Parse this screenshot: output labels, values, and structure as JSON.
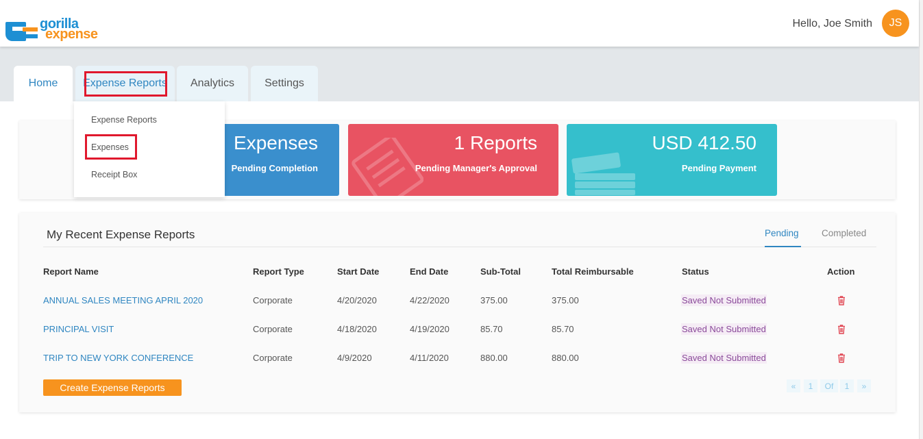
{
  "header": {
    "logo": {
      "word1": "gorilla",
      "word2": "expense"
    },
    "greeting": "Hello, Joe Smith",
    "avatar_initials": "JS"
  },
  "tabs": [
    {
      "label": "Home",
      "active": true
    },
    {
      "label": "Expense Reports",
      "highlighted": true
    },
    {
      "label": "Analytics"
    },
    {
      "label": "Settings"
    }
  ],
  "dropdown": {
    "items": [
      {
        "label": "Expense Reports"
      },
      {
        "label": "Expenses",
        "highlighted": true
      },
      {
        "label": "Receipt Box"
      }
    ]
  },
  "summary_cards": [
    {
      "amount": "Expenses",
      "caption": "Pending Completion",
      "color": "#3a8fcd"
    },
    {
      "amount": "1 Reports",
      "caption": "Pending Manager's Approval",
      "color": "#e85362"
    },
    {
      "amount": "USD 412.50",
      "caption": "Pending Payment",
      "color": "#35bfcc"
    }
  ],
  "reports": {
    "title": "My Recent Expense Reports",
    "filter_tabs": {
      "pending": "Pending",
      "completed": "Completed",
      "active": "Pending"
    },
    "columns": [
      "Report Name",
      "Report Type",
      "Start Date",
      "End Date",
      "Sub-Total",
      "Total Reimbursable",
      "Status",
      "Action"
    ],
    "rows": [
      {
        "name": "ANNUAL SALES MEETING APRIL 2020",
        "type": "Corporate",
        "start": "4/20/2020",
        "end": "4/22/2020",
        "subtotal": "375.00",
        "reimbursable": "375.00",
        "status": "Saved Not Submitted",
        "action_icon": "trash-icon"
      },
      {
        "name": "PRINCIPAL VISIT",
        "type": "Corporate",
        "start": "4/18/2020",
        "end": "4/19/2020",
        "subtotal": "85.70",
        "reimbursable": "85.70",
        "status": "Saved Not Submitted",
        "action_icon": "trash-icon"
      },
      {
        "name": "TRIP TO NEW YORK CONFERENCE",
        "type": "Corporate",
        "start": "4/9/2020",
        "end": "4/11/2020",
        "subtotal": "880.00",
        "reimbursable": "880.00",
        "status": "Saved Not Submitted",
        "action_icon": "trash-icon"
      }
    ],
    "create_button": "Create Expense Reports",
    "pager": {
      "first": "«",
      "current": "1",
      "of": "Of",
      "total": "1",
      "last": "»"
    }
  },
  "colors": {
    "accent": "#2f86c1",
    "orange": "#f7931e",
    "highlight": "#e0182d"
  }
}
